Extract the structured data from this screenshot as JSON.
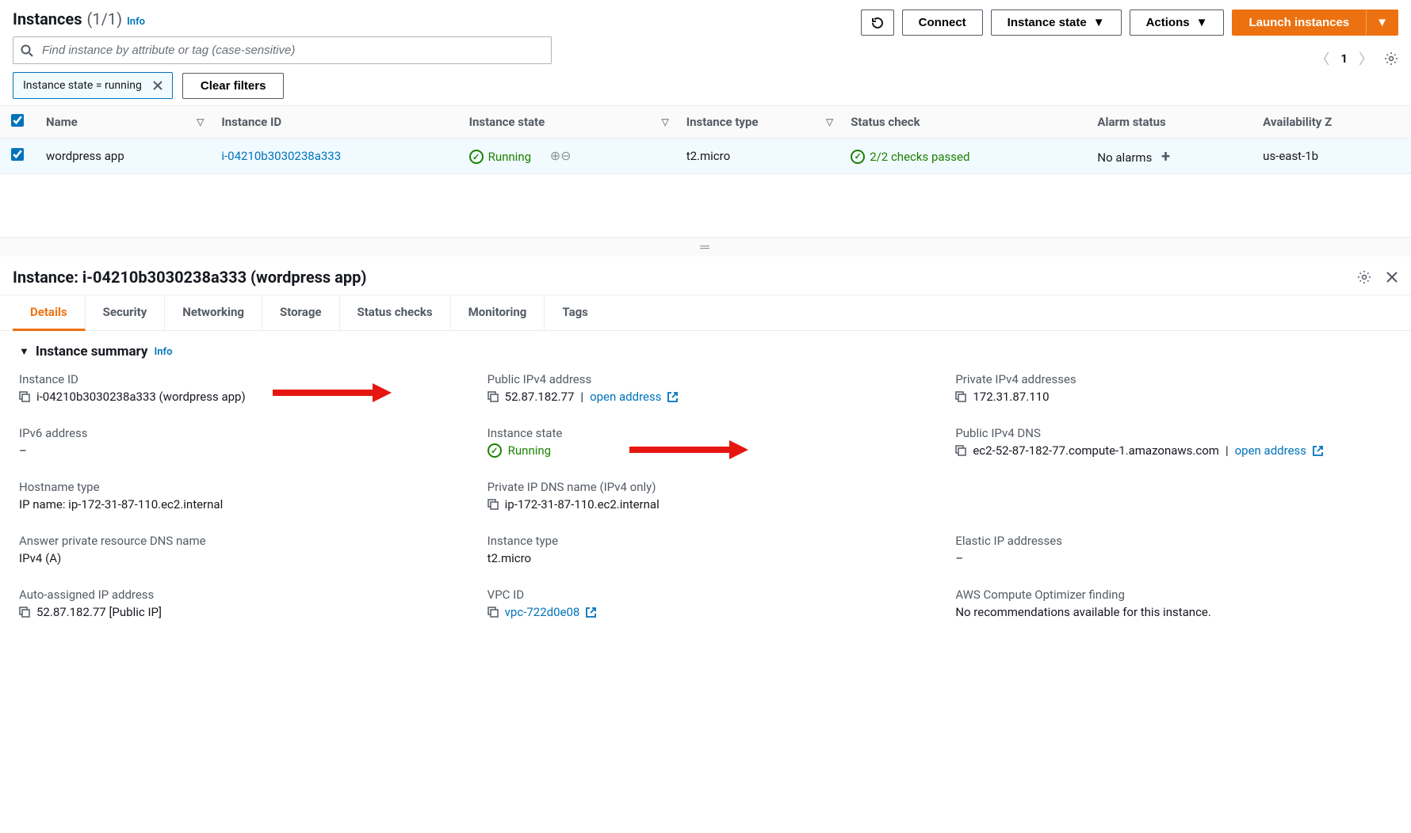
{
  "header": {
    "title": "Instances",
    "count": "(1/1)",
    "info_label": "Info",
    "search_placeholder": "Find instance by attribute or tag (case-sensitive)",
    "filter_chip": "Instance state = running",
    "clear_filters": "Clear filters",
    "buttons": {
      "connect": "Connect",
      "instance_state": "Instance state",
      "actions": "Actions",
      "launch": "Launch instances"
    },
    "page_number": "1"
  },
  "table": {
    "columns": {
      "name": "Name",
      "instance_id": "Instance ID",
      "instance_state": "Instance state",
      "instance_type": "Instance type",
      "status_check": "Status check",
      "alarm_status": "Alarm status",
      "availability": "Availability Z"
    },
    "row": {
      "name": "wordpress app",
      "instance_id": "i-04210b3030238a333",
      "instance_state": "Running",
      "instance_type": "t2.micro",
      "status_check": "2/2 checks passed",
      "alarm_status": "No alarms",
      "availability": "us-east-1b"
    }
  },
  "detail": {
    "title": "Instance: i-04210b3030238a333 (wordpress app)",
    "tabs": {
      "details": "Details",
      "security": "Security",
      "networking": "Networking",
      "storage": "Storage",
      "status_checks": "Status checks",
      "monitoring": "Monitoring",
      "tags": "Tags"
    },
    "summary": {
      "head": "Instance summary",
      "info": "Info",
      "items": {
        "instance_id_label": "Instance ID",
        "instance_id_value": "i-04210b3030238a333 (wordpress app)",
        "public_ipv4_label": "Public IPv4 address",
        "public_ipv4_value": "52.87.182.77",
        "public_ipv4_open": "open address",
        "private_ipv4_label": "Private IPv4 addresses",
        "private_ipv4_value": "172.31.87.110",
        "ipv6_label": "IPv6 address",
        "ipv6_value": "–",
        "instance_state_label": "Instance state",
        "instance_state_value": "Running",
        "public_dns_label": "Public IPv4 DNS",
        "public_dns_value": "ec2-52-87-182-77.compute-1.amazonaws.com",
        "public_dns_open": "open address",
        "hostname_type_label": "Hostname type",
        "hostname_type_value": "IP name: ip-172-31-87-110.ec2.internal",
        "private_dns_label": "Private IP DNS name (IPv4 only)",
        "private_dns_value": "ip-172-31-87-110.ec2.internal",
        "answer_dns_label": "Answer private resource DNS name",
        "answer_dns_value": "IPv4 (A)",
        "instance_type_label": "Instance type",
        "instance_type_value": "t2.micro",
        "elastic_ip_label": "Elastic IP addresses",
        "elastic_ip_value": "–",
        "auto_ip_label": "Auto-assigned IP address",
        "auto_ip_value": "52.87.182.77 [Public IP]",
        "vpc_label": "VPC ID",
        "vpc_value": "vpc-722d0e08",
        "optimizer_label": "AWS Compute Optimizer finding",
        "optimizer_value": "No recommendations available for this instance."
      }
    }
  }
}
